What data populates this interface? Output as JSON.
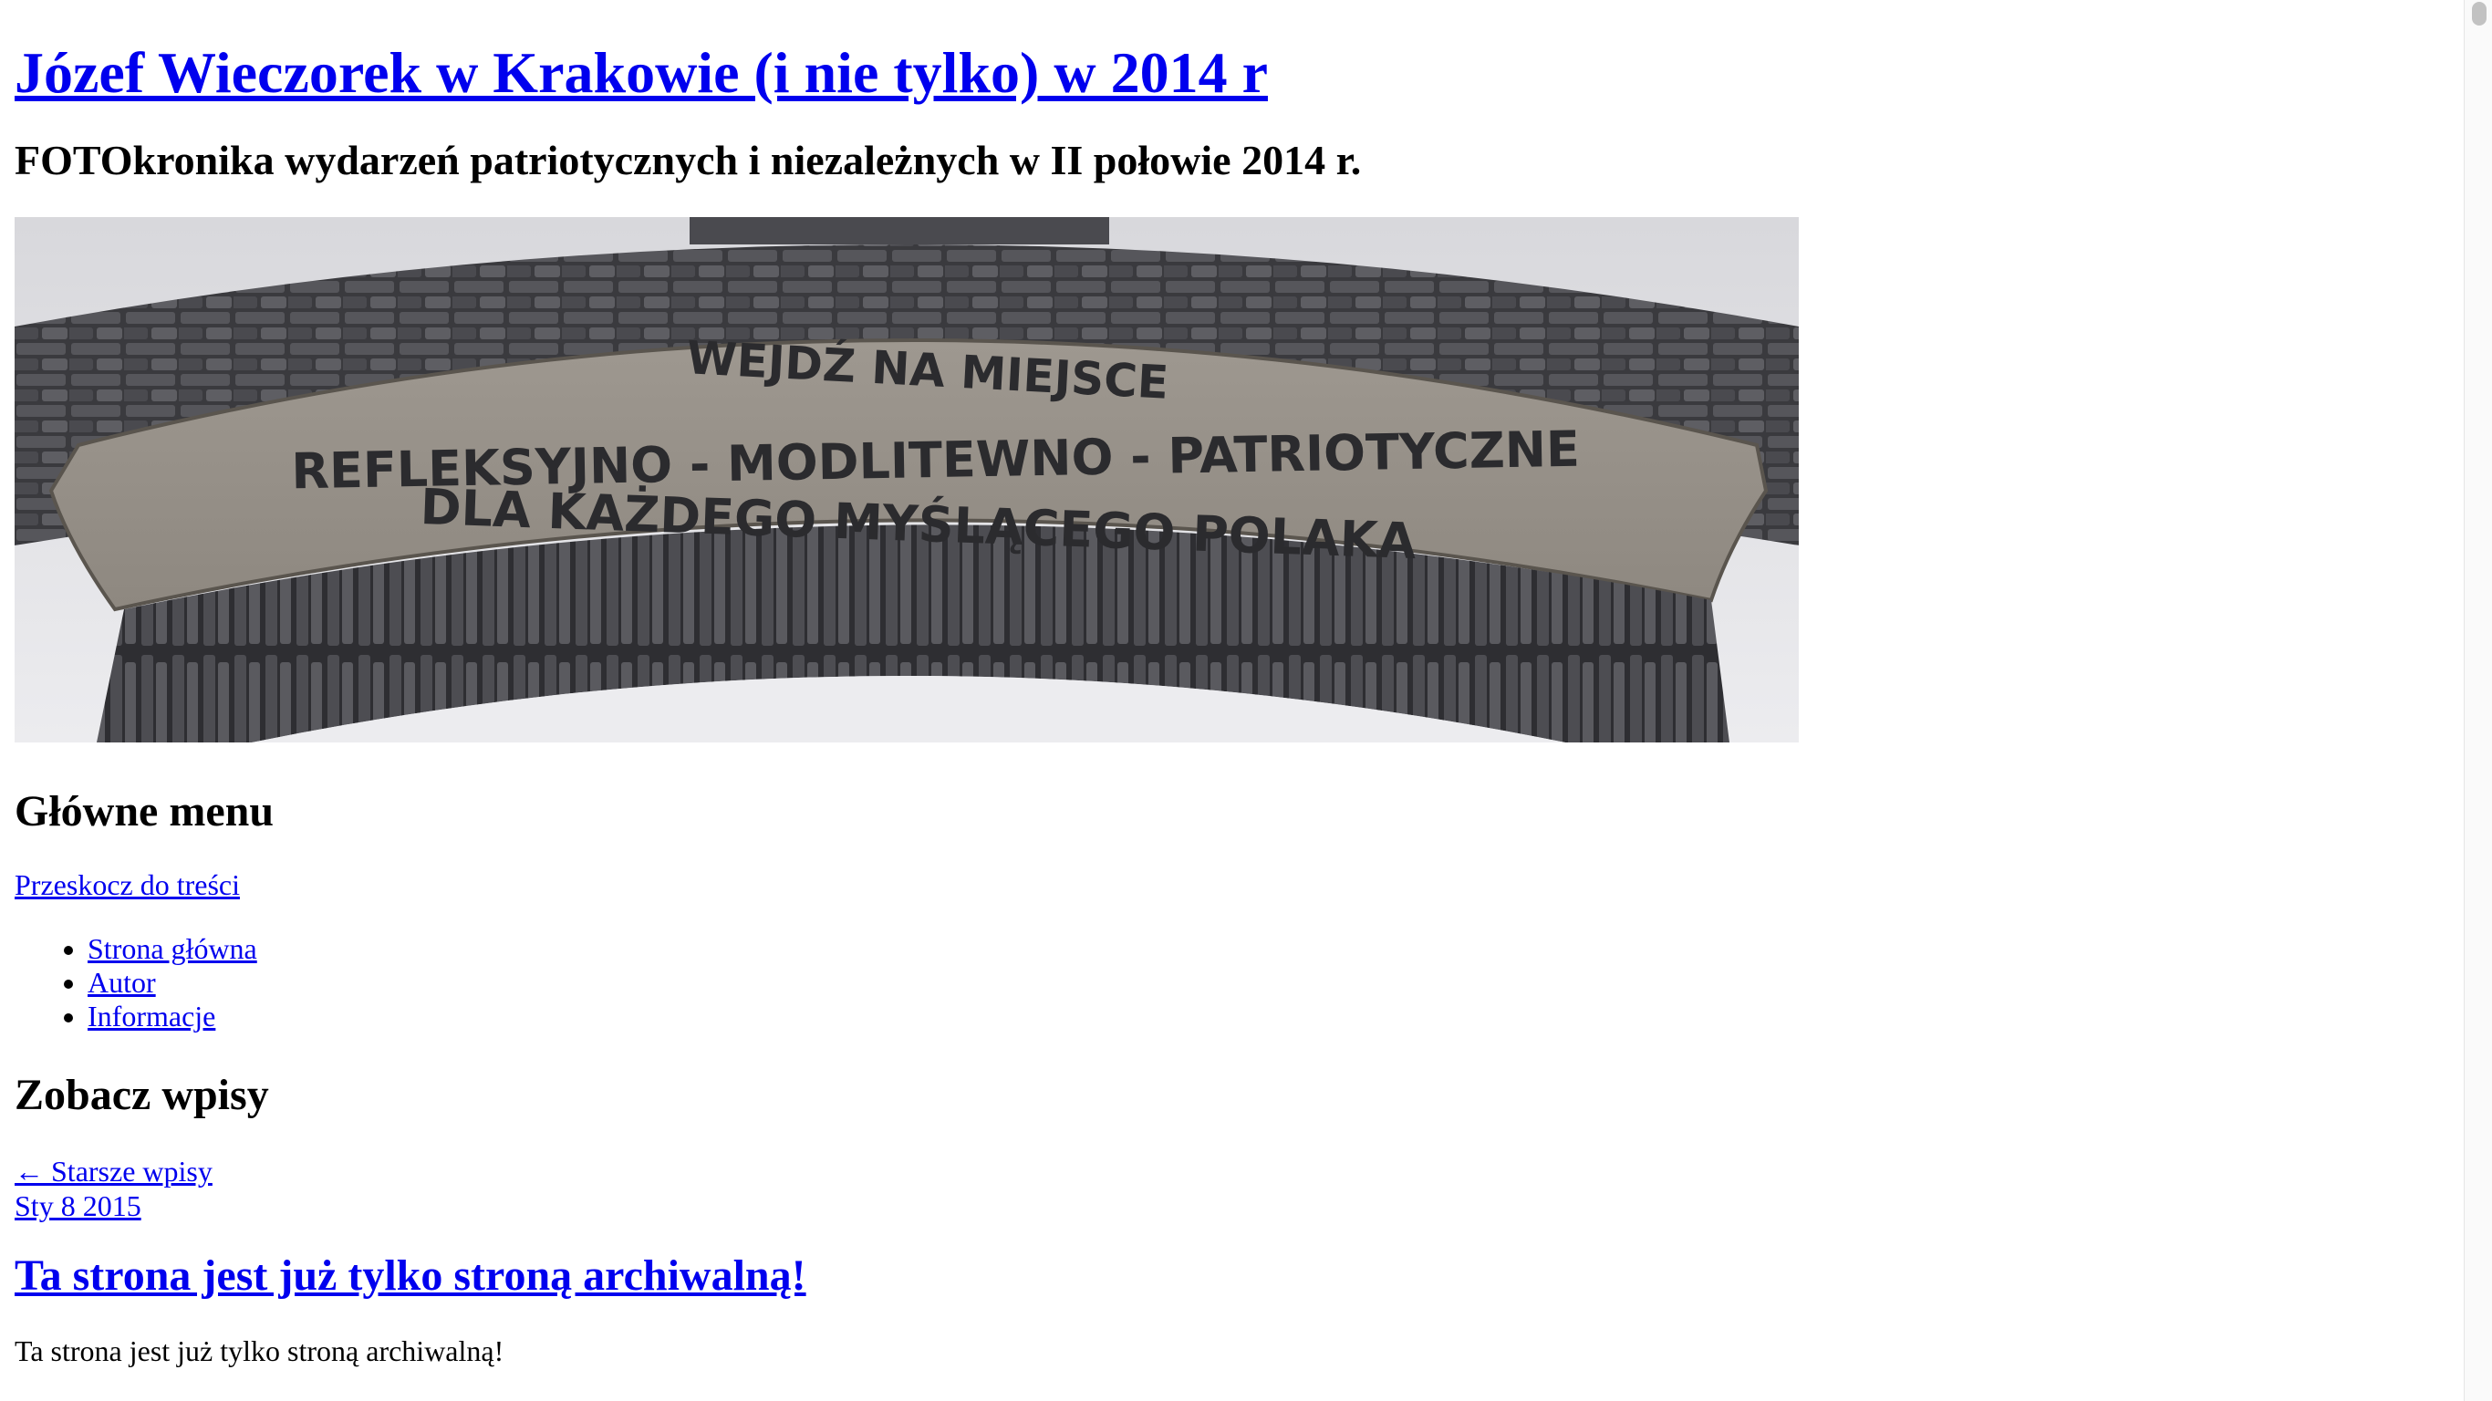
{
  "header": {
    "site_title": "Józef Wieczorek w Krakowie (i nie tylko) w 2014 r",
    "site_description": "FOTOkronika wydarzeń patriotycznych i niezależnych w II połowie 2014 r.",
    "banner_inscription": [
      "WEJDŹ NA MIEJSCE",
      "REFLEKSYJNO - MODLITEWNO - PATRIOTYCZNE",
      "DLA KAŻDEGO MYŚLĄCEGO POLAKA"
    ]
  },
  "nav": {
    "heading": "Główne menu",
    "skip_link": "Przeskocz do treści",
    "items": [
      {
        "label": "Strona główna"
      },
      {
        "label": "Autor"
      },
      {
        "label": "Informacje"
      }
    ]
  },
  "entries": {
    "heading": "Zobacz wpisy",
    "older_link": "← Starsze wpisy",
    "post": {
      "date": "Sty 8 2015",
      "title": "Ta strona jest już tylko stroną archiwalną!",
      "body": "Ta strona jest już tylko stroną archiwalną!"
    }
  },
  "colors": {
    "link": "#0000ee",
    "text": "#000000",
    "background": "#ffffff"
  }
}
